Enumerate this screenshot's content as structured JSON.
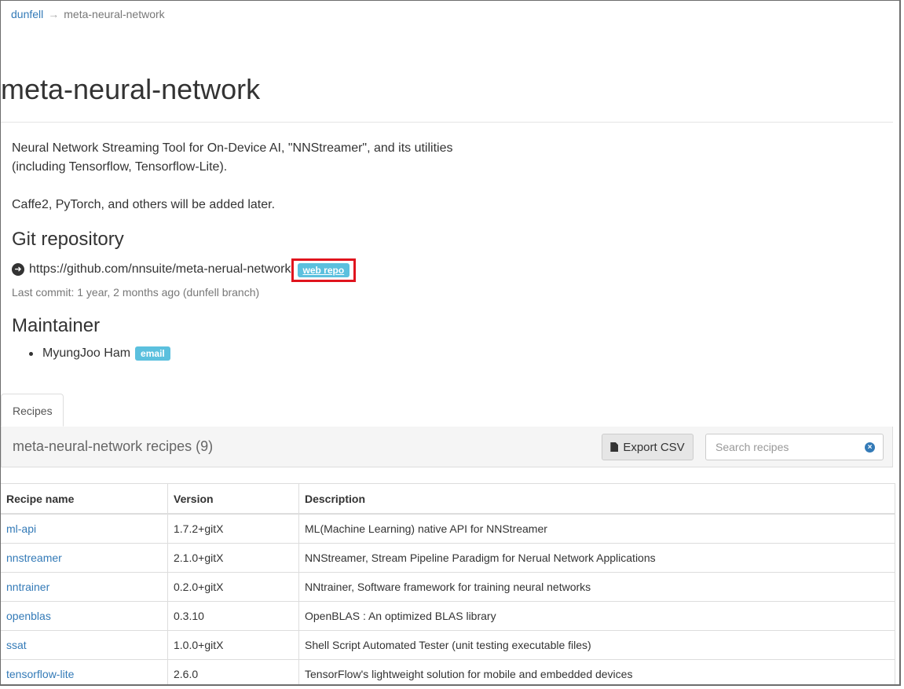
{
  "breadcrumb": {
    "parent": "dunfell",
    "separator": "→",
    "current": "meta-neural-network"
  },
  "page_title": "meta-neural-network",
  "description": {
    "line1": "Neural Network Streaming Tool for On-Device AI, \"NNStreamer\", and its utilities",
    "line2": "(including Tensorflow, Tensorflow-Lite).",
    "para2": "Caffe2, PyTorch, and others will be added later."
  },
  "git": {
    "heading": "Git repository",
    "url": "https://github.com/nnsuite/meta-nerual-network",
    "web_repo_label": "web repo",
    "last_commit": "Last commit: 1 year, 2 months ago (dunfell branch)"
  },
  "maintainer": {
    "heading": "Maintainer",
    "name": "MyungJoo Ham",
    "email_label": "email"
  },
  "tabs": [
    {
      "label": "Recipes"
    }
  ],
  "panel": {
    "title": "meta-neural-network recipes (9)",
    "export_label": "Export CSV",
    "search_placeholder": "Search recipes"
  },
  "table": {
    "headers": [
      "Recipe name",
      "Version",
      "Description"
    ],
    "rows": [
      {
        "name": "ml-api",
        "version": "1.7.2+gitX",
        "description": "ML(Machine Learning) native API for NNStreamer"
      },
      {
        "name": "nnstreamer",
        "version": "2.1.0+gitX",
        "description": "NNStreamer, Stream Pipeline Paradigm for Nerual Network Applications"
      },
      {
        "name": "nntrainer",
        "version": "0.2.0+gitX",
        "description": "NNtrainer, Software framework for training neural networks"
      },
      {
        "name": "openblas",
        "version": "0.3.10",
        "description": "OpenBLAS : An optimized BLAS library"
      },
      {
        "name": "ssat",
        "version": "1.0.0+gitX",
        "description": "Shell Script Automated Tester (unit testing executable files)"
      },
      {
        "name": "tensorflow-lite",
        "version": "2.6.0",
        "description": "TensorFlow's lightweight solution for mobile and embedded devices"
      }
    ]
  },
  "colors": {
    "link": "#337ab7",
    "label_info": "#5bc0de",
    "highlight": "#e0141e"
  }
}
